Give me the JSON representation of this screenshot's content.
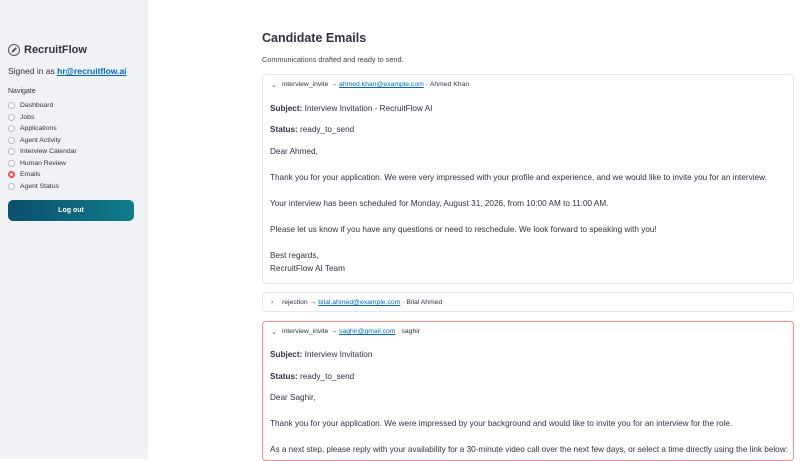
{
  "sidebar": {
    "brand": "RecruitFlow",
    "signed_prefix": "Signed in as",
    "signed_email": "hr@recruitflow.ai",
    "nav_title": "Navigate",
    "items": [
      {
        "label": "Dashboard",
        "selected": false
      },
      {
        "label": "Jobs",
        "selected": false
      },
      {
        "label": "Applications",
        "selected": false
      },
      {
        "label": "Agent Activity",
        "selected": false
      },
      {
        "label": "Interview Calendar",
        "selected": false
      },
      {
        "label": "Human Review",
        "selected": false
      },
      {
        "label": "Emails",
        "selected": true
      },
      {
        "label": "Agent Status",
        "selected": false
      }
    ],
    "logout_label": "Log out"
  },
  "main": {
    "title": "Candidate Emails",
    "subtitle": "Communications drafted and ready to send.",
    "emails": [
      {
        "type": "interview_invite",
        "arrow": "→",
        "email": "ahmed.khan@example.com",
        "sep": "·",
        "name": "Ahmed Khan",
        "subject_label": "Subject:",
        "subject": "Interview Invitation - RecruitFlow AI",
        "status_label": "Status:",
        "status": "ready_to_send",
        "lines": [
          "Dear Ahmed,",
          "Thank you for your application. We were very impressed with your profile and experience, and we would like to invite you for an interview.",
          "Your interview has been scheduled for Monday, August 31, 2026, from 10:00 AM to 11:00 AM.",
          "Please let us know if you have any questions or need to reschedule. We look forward to speaking with you!",
          "Best regards,",
          "RecruitFlow AI Team"
        ]
      },
      {
        "type": "rejection",
        "arrow": "→",
        "email": "bilal.ahmed@example.com",
        "sep": "·",
        "name": "Bilal Ahmed"
      },
      {
        "type": "interview_invite",
        "arrow": "→",
        "email": "saghir@gmail.com",
        "sep": "·",
        "name": "saghir",
        "subject_label": "Subject:",
        "subject": "Interview Invitation",
        "status_label": "Status:",
        "status": "ready_to_send",
        "lines": [
          "Dear Saghir,",
          "Thank you for your application. We were impressed by your background and would like to invite you for an interview for the role.",
          "As a next step, please reply with your availability for a 30-minute video call over the next few days, or select a time directly using the link below:"
        ]
      }
    ]
  },
  "colors": {
    "accent": "#ff4b4b",
    "link": "#0068c9",
    "sidebar_bg": "#f0f2f6",
    "button": "#0b4f6c"
  }
}
